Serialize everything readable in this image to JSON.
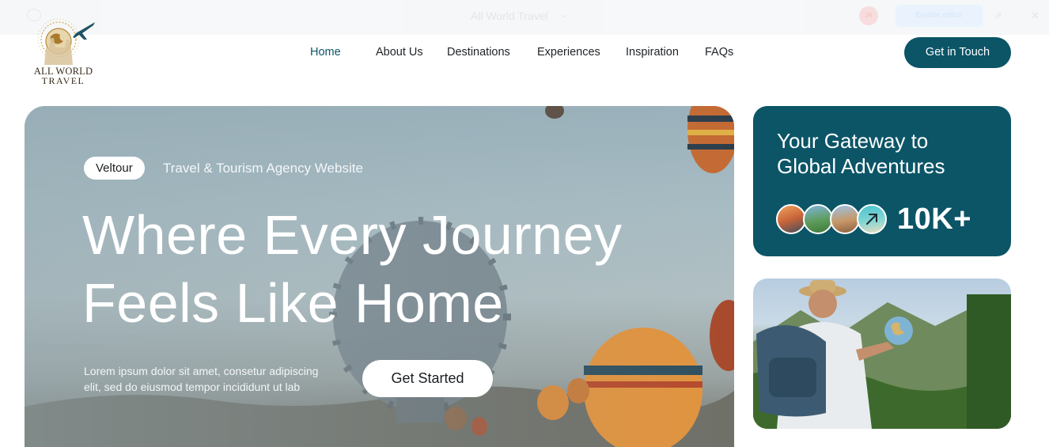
{
  "editor_bar": {
    "site_name": "All World Travel",
    "caret": "⌄",
    "avatar_initials": "JR",
    "publish_label": "Enable editor",
    "share_icon": "share-icon",
    "close_icon": "close-icon"
  },
  "brand": {
    "logo_line1": "ALL WORLD",
    "logo_line2": "TRAVEL",
    "logo_icon": "globe-airplane-logo",
    "colors": {
      "primary": "#0b5567",
      "logo_gold": "#b8893a"
    }
  },
  "nav": {
    "items": [
      {
        "label": "Home",
        "active": true
      },
      {
        "label": "About Us",
        "active": false
      },
      {
        "label": "Destinations",
        "active": false
      },
      {
        "label": "Experiences",
        "active": false
      },
      {
        "label": "Inspiration",
        "active": false
      },
      {
        "label": "FAQs",
        "active": false
      }
    ],
    "cta_label": "Get in Touch"
  },
  "hero": {
    "chip": "Veltour",
    "tagline": "Travel & Tourism Agency Website",
    "headline_line1": "Where Every Journey",
    "headline_line2": "Feels Like Home",
    "subtext_line1": "Lorem ipsum dolor sit amet, consetur adipiscing",
    "subtext_line2": "elit, sed do eiusmod tempor incididunt ut lab",
    "button_label": "Get Started",
    "background_icon": "hot-air-balloons-photo"
  },
  "gateway_card": {
    "title_line1": "Your Gateway to",
    "title_line2": "Global Adventures",
    "stat": "10K+",
    "thumbnails": [
      "venice-thumb",
      "island-thumb",
      "city-thumb",
      "beach-thumb"
    ],
    "arrow_icon": "arrow-up-right-icon"
  },
  "photo_card": {
    "image": "traveler-holding-globe-photo"
  }
}
